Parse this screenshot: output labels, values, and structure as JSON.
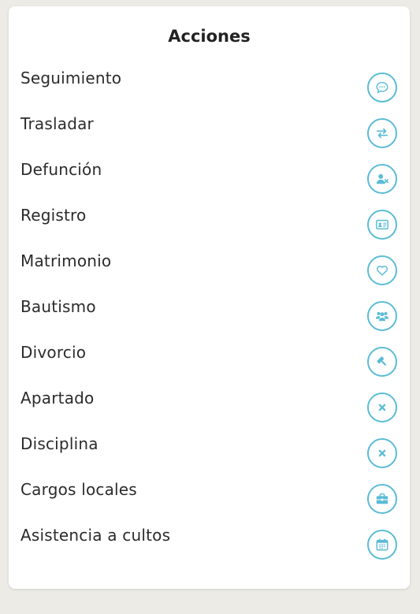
{
  "panel": {
    "title": "Acciones"
  },
  "actions": [
    {
      "label": "Seguimiento",
      "icon": "comment-icon"
    },
    {
      "label": "Trasladar",
      "icon": "transfer-arrows-icon"
    },
    {
      "label": "Defunción",
      "icon": "user-remove-icon"
    },
    {
      "label": "Registro",
      "icon": "id-card-icon"
    },
    {
      "label": "Matrimonio",
      "icon": "heart-icon"
    },
    {
      "label": "Bautismo",
      "icon": "users-group-icon"
    },
    {
      "label": "Divorcio",
      "icon": "gavel-icon"
    },
    {
      "label": "Apartado",
      "icon": "close-x-icon"
    },
    {
      "label": "Disciplina",
      "icon": "close-x-icon"
    },
    {
      "label": "Cargos locales",
      "icon": "briefcase-icon"
    },
    {
      "label": "Asistencia a cultos",
      "icon": "calendar-icon"
    }
  ],
  "colors": {
    "accent": "#5bbcd6",
    "background": "#ecebe6",
    "card": "#ffffff",
    "text": "#2b2b2b"
  }
}
